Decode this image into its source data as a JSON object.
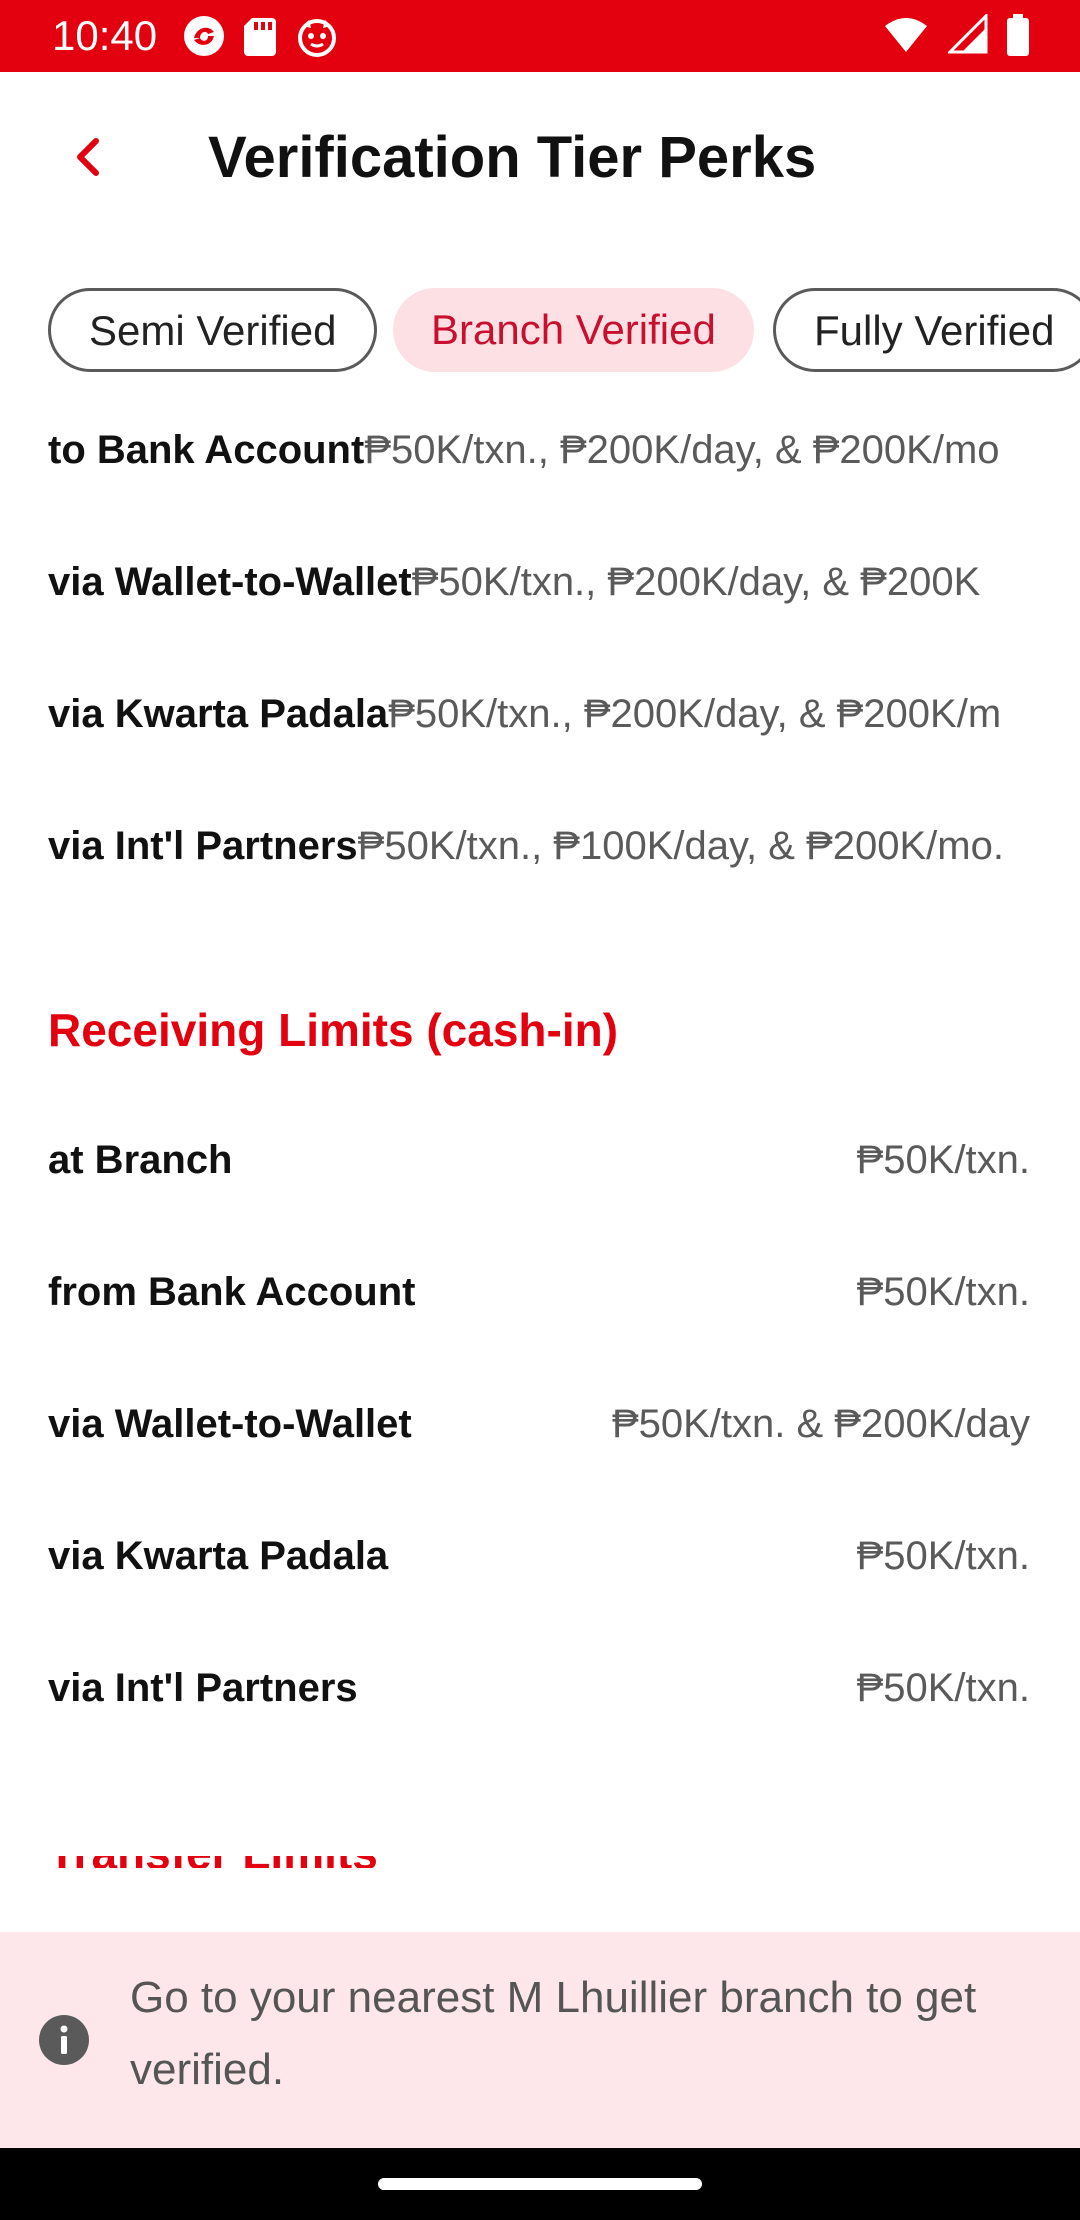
{
  "status_bar": {
    "time": "10:40",
    "app_icons": [
      "app-notification-icon",
      "sd-card-icon",
      "cat-face-icon"
    ],
    "system_icons": [
      "wifi-icon",
      "signal-icon",
      "battery-icon"
    ]
  },
  "header": {
    "title": "Verification Tier Perks",
    "back_icon": "chevron-left-icon"
  },
  "tabs": [
    {
      "label": "Semi Verified",
      "selected": false
    },
    {
      "label": "Branch Verified",
      "selected": true
    },
    {
      "label": "Fully Verified",
      "selected": false
    }
  ],
  "sending_limits": {
    "rows": [
      {
        "label": "to Bank Account",
        "value": "₱50K/txn., ₱200K/day, & ₱200K/mo"
      },
      {
        "label": "via Wallet-to-Wallet",
        "value": "₱50K/txn., ₱200K/day, & ₱200K"
      },
      {
        "label": "via Kwarta Padala",
        "value": "₱50K/txn., ₱200K/day, & ₱200K/m"
      },
      {
        "label": "via Int'l Partners",
        "value": "₱50K/txn., ₱100K/day, & ₱200K/mo."
      }
    ]
  },
  "receiving_limits": {
    "title": "Receiving Limits (cash-in)",
    "rows": [
      {
        "label": "at Branch",
        "value": "₱50K/txn."
      },
      {
        "label": "from Bank Account",
        "value": "₱50K/txn."
      },
      {
        "label": "via Wallet-to-Wallet",
        "value": "₱50K/txn. & ₱200K/day"
      },
      {
        "label": "via Kwarta Padala",
        "value": "₱50K/txn."
      },
      {
        "label": "via Int'l Partners",
        "value": "₱50K/txn."
      }
    ]
  },
  "next_section_title_partial": "Transfer Limits",
  "info_banner": {
    "icon": "info-icon",
    "text": "Go to your nearest M Lhuillier branch to get verified."
  },
  "colors": {
    "accent_red": "#e3000f",
    "selected_tab_bg": "#fde0e3",
    "banner_bg": "#fde7ea"
  }
}
